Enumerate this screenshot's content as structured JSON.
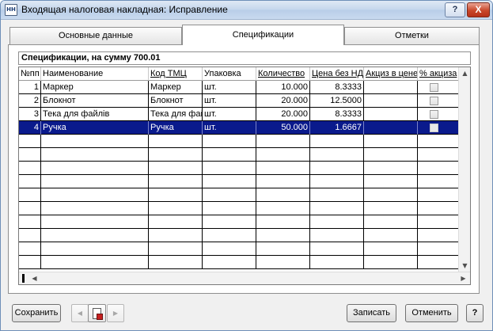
{
  "window": {
    "title": "Входящая налоговая накладная: Исправление",
    "title_icon": "document-app-icon",
    "help_glyph": "?",
    "close_glyph": "X"
  },
  "tabs": [
    {
      "label": "Основные данные",
      "active": false
    },
    {
      "label": "Спецификации",
      "active": true
    },
    {
      "label": "Отметки",
      "active": false
    }
  ],
  "spec": {
    "caption": "Спецификации, на сумму 700.01",
    "columns": [
      "№пп",
      "Наименование",
      "Код ТМЦ",
      "Упаковка",
      "Количество",
      "Цена без НДС",
      "Акциз в цене",
      "% акциза"
    ],
    "rows": [
      {
        "n": "1",
        "name": "Маркер",
        "code": "Маркер",
        "pack": "шт.",
        "qty": "10.000",
        "price": "8.3333",
        "excise": "",
        "pct_checked": false,
        "selected": false
      },
      {
        "n": "2",
        "name": "Блокнот",
        "code": "Блокнот",
        "pack": "шт.",
        "qty": "20.000",
        "price": "12.5000",
        "excise": "",
        "pct_checked": false,
        "selected": false
      },
      {
        "n": "3",
        "name": "Тека для файлів",
        "code": "Тека для фай",
        "pack": "шт.",
        "qty": "20.000",
        "price": "8.3333",
        "excise": "",
        "pct_checked": false,
        "selected": false
      },
      {
        "n": "4",
        "name": "Ручка",
        "code": "Ручка",
        "pack": "шт.",
        "qty": "50.000",
        "price": "1.6667",
        "excise": "",
        "pct_checked": false,
        "selected": true
      }
    ],
    "empty_rows": 10
  },
  "footer": {
    "save_label": "Сохранить",
    "write_label": "Записать",
    "cancel_label": "Отменить",
    "help_label": "?"
  },
  "colors": {
    "selection": "#0a1a8c",
    "close_button": "#c9472a"
  }
}
